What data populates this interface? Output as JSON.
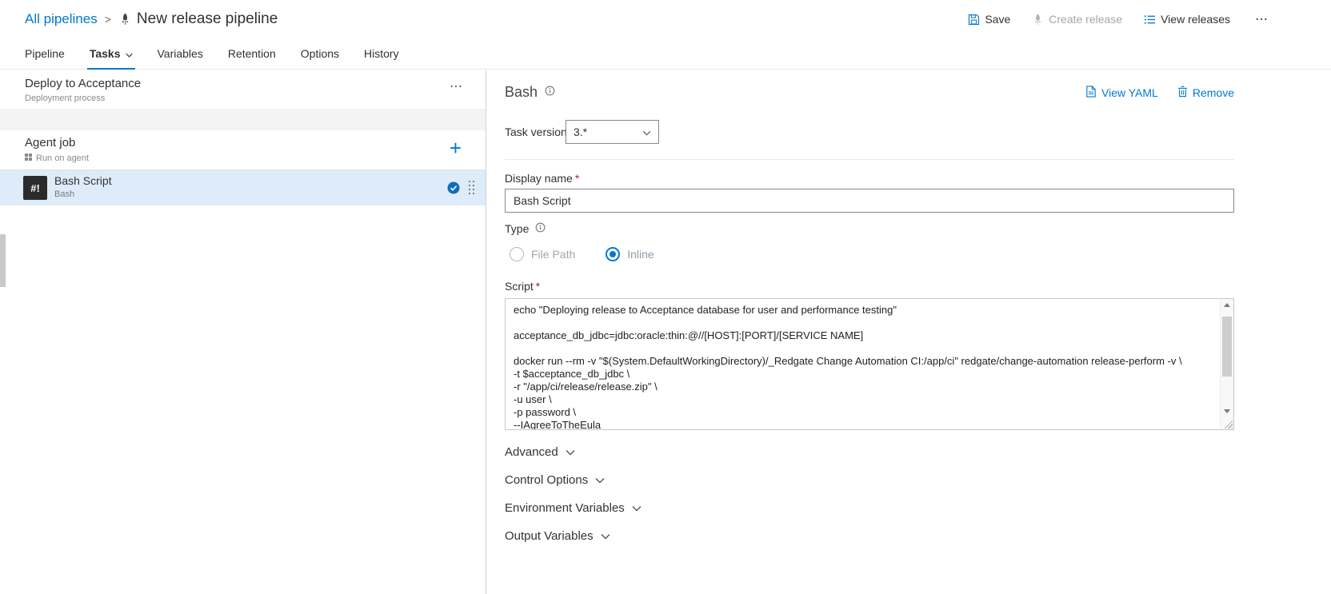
{
  "colors": {
    "accent": "#0078d4",
    "selected_row_bg": "#deecf9",
    "task_icon_bg": "#2b2b2b"
  },
  "header": {
    "breadcrumb": "All pipelines",
    "breadcrumb_separator": ">",
    "title": "New release pipeline",
    "commands": {
      "save": "Save",
      "create_release": "Create release",
      "view_releases": "View releases",
      "more": "⋯"
    }
  },
  "tabs": [
    {
      "label": "Pipeline",
      "active": false
    },
    {
      "label": "Tasks",
      "active": true
    },
    {
      "label": "Variables",
      "active": false
    },
    {
      "label": "Retention",
      "active": false
    },
    {
      "label": "Options",
      "active": false
    },
    {
      "label": "History",
      "active": false
    }
  ],
  "left_panel": {
    "stage": {
      "title": "Deploy to Acceptance",
      "subtitle": "Deployment process",
      "more": "⋯"
    },
    "agent_job": {
      "title": "Agent job",
      "subtitle": "Run on agent",
      "add": "+"
    },
    "task": {
      "icon_text": "#!",
      "title": "Bash Script",
      "subtitle": "Bash"
    }
  },
  "task_panel": {
    "title": "Bash",
    "view_yaml": "View YAML",
    "remove": "Remove",
    "task_version_label": "Task version",
    "task_version_value": "3.*",
    "display_name_label": "Display name",
    "required_marker": "*",
    "display_name_value": "Bash Script",
    "type_label": "Type",
    "radio_file_path": "File Path",
    "radio_inline": "Inline",
    "script_label": "Script",
    "script_value": "echo \"Deploying release to Acceptance database for user and performance testing\"\n\nacceptance_db_jdbc=jdbc:oracle:thin:@//[HOST]:[PORT]/[SERVICE NAME]\n\ndocker run --rm -v \"$(System.DefaultWorkingDirectory)/_Redgate Change Automation CI:/app/ci\" redgate/change-automation release-perform -v \\\n-t $acceptance_db_jdbc \\\n-r \"/app/ci/release/release.zip\" \\\n-u user \\\n-p password \\\n--IAgreeToTheEula",
    "sections": [
      "Advanced",
      "Control Options",
      "Environment Variables",
      "Output Variables"
    ]
  }
}
